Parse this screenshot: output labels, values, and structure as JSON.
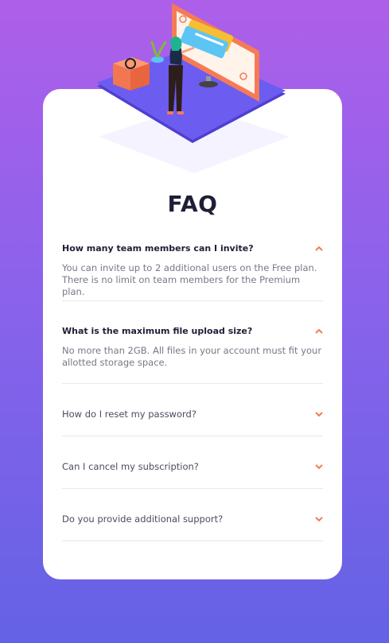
{
  "page": {
    "title": "FAQ"
  },
  "faq": [
    {
      "question": "How many team members can I invite?",
      "answer": "You can invite up to 2 additional users on the Free plan. There is no limit on team members for the Premium plan.",
      "open": true
    },
    {
      "question": "What is the maximum file upload size?",
      "answer": "No more than 2GB. All files in your account must fit your allotted storage space.",
      "open": true
    },
    {
      "question": "How do I reset my password?",
      "answer": "",
      "open": false
    },
    {
      "question": "Can I cancel my subscription?",
      "answer": "",
      "open": false
    },
    {
      "question": "Do you provide additional support?",
      "answer": "",
      "open": false
    }
  ],
  "colors": {
    "accent": "#F47B56",
    "heading": "#1E1F36",
    "answer_text": "#787887",
    "background_top": "#AE5FE9",
    "background_bottom": "#6462E5"
  },
  "icons": {
    "expand": "chevron-down-icon",
    "collapse": "chevron-up-icon"
  }
}
